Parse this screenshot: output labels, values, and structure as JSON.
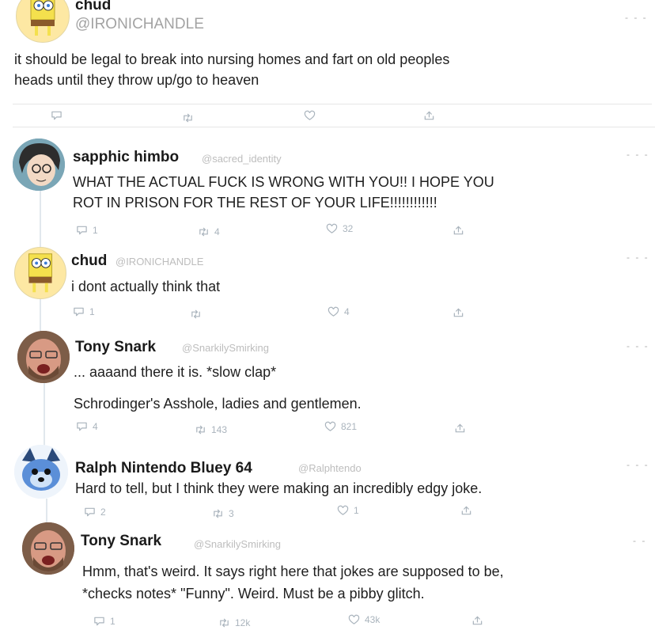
{
  "colors": {
    "text": "#1f1f1f",
    "muted": "#bdbdbd",
    "icon": "#aab4bd",
    "line": "#e1e8ed"
  },
  "original": {
    "name": "chud",
    "handle": "@IRONICHANDLE",
    "text_lines": [
      "it should be legal to break into nursing homes and fart on old peoples",
      "heads until they throw up/go to heaven"
    ],
    "menu": "- - -"
  },
  "replies": [
    {
      "name": "sapphic himbo",
      "handle": "@sacred_identity",
      "text_lines": [
        "WHAT THE ACTUAL FUCK IS WRONG WITH YOU!! I HOPE YOU",
        "ROT IN PRISON FOR THE REST OF YOUR LIFE!!!!!!!!!!!!"
      ],
      "replies": "1",
      "retweets": "4",
      "likes": "32",
      "menu": "- - -"
    },
    {
      "name": "chud",
      "handle": "@IRONICHANDLE",
      "text_lines": [
        "i dont actually think that"
      ],
      "replies": "1",
      "retweets": "",
      "likes": "4",
      "menu": "- - -"
    },
    {
      "name": "Tony Snark",
      "handle": "@SnarkilySmirking",
      "text_lines": [
        "... aaaand there it is. *slow clap*",
        "Schrodinger's Asshole, ladies and gentlemen."
      ],
      "replies": "4",
      "retweets": "143",
      "likes": "821",
      "menu": "- - -"
    },
    {
      "name": "Ralph Nintendo Bluey 64",
      "handle": "@Ralphtendo",
      "text_lines": [
        "Hard to tell, but I think they were making an incredibly edgy joke."
      ],
      "replies": "2",
      "retweets": "3",
      "likes": "1",
      "menu": "- - -"
    },
    {
      "name": "Tony Snark",
      "handle": "@SnarkilySmirking",
      "text_lines": [
        "Hmm, that's weird. It says right here that jokes are supposed to be,",
        "*checks notes* \"Funny\". Weird. Must be a pibby glitch."
      ],
      "replies": "1",
      "retweets": "12k",
      "likes": "43k",
      "menu": "- -"
    }
  ]
}
